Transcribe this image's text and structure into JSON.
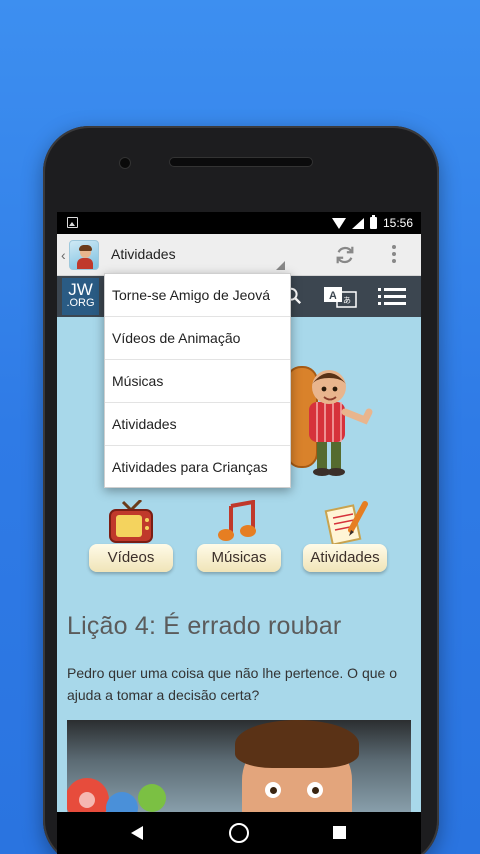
{
  "status_bar": {
    "time": "15:56"
  },
  "action_bar": {
    "selected_section": "Atividades"
  },
  "jw_header": {
    "logo_line1": "JW",
    "logo_line2": ".ORG"
  },
  "dropdown": {
    "items": [
      "Torne-se Amigo de Jeová",
      "Vídeos de Animação",
      "Músicas",
      "Atividades",
      "Atividades para Crianças"
    ]
  },
  "categories": [
    {
      "label": "Vídeos",
      "icon": "tv-icon"
    },
    {
      "label": "Músicas",
      "icon": "music-notes-icon"
    },
    {
      "label": "Atividades",
      "icon": "notepad-pencil-icon"
    }
  ],
  "lesson": {
    "title": "Lição 4: É errado roubar",
    "description": "Pedro quer uma coisa que não lhe pertence. O que o ajuda a tomar a decisão certa?"
  },
  "colors": {
    "page_background": "#a8d8ea",
    "jw_header": "#3c4650",
    "jw_logo": "#2a5b84",
    "outer_background": "#3d8ff0"
  }
}
